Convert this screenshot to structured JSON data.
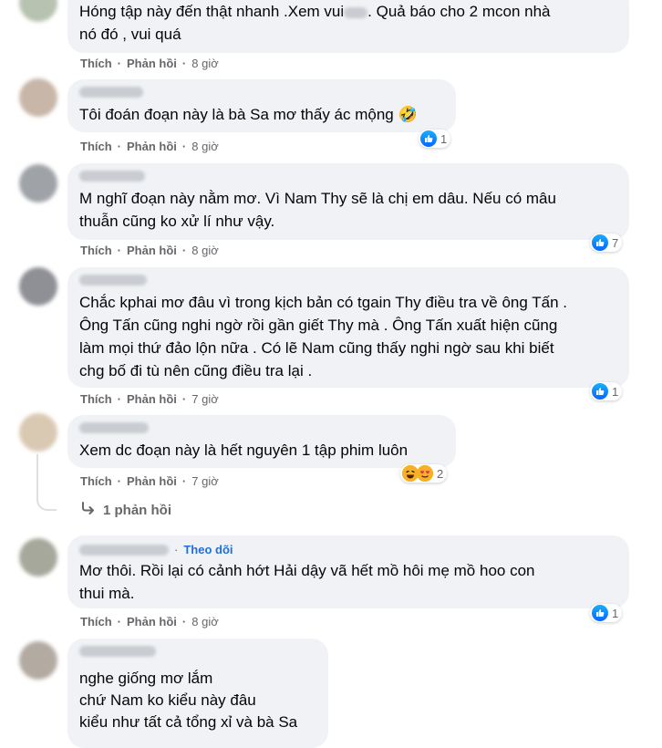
{
  "actions": {
    "like": "Thích",
    "reply": "Phản hồi",
    "dot": "·"
  },
  "colors": {
    "like_blue": "#0766ff",
    "bubble_bg": "#f0f2f5",
    "meta_gray": "#65676b",
    "follow_blue": "#216fdb"
  },
  "comments": [
    {
      "text": "Hóng tập này đến thật nhanh .Xem vui",
      "text_after_blur": ". Quả báo cho 2 mcon nhà\nnó đó , vui quá",
      "time": "8 giờ"
    },
    {
      "text": "Tôi đoán đoạn này là bà Sa mơ thấy ác mộng 🤣",
      "time": "8 giờ",
      "reaction_icon": "like-icon",
      "reaction_count": "1"
    },
    {
      "text": "M nghĩ đoạn này nằm mơ. Vì Nam Thy sẽ là chị em dâu. Nếu có mâu\nthuẫn cũng ko xử lí như vậy.",
      "time": "8 giờ",
      "reaction_icon": "like-icon",
      "reaction_count": "7"
    },
    {
      "text": "Chắc kphai mơ đâu vì trong kịch bản có tgain Thy điều tra về ông Tấn .\nÔng Tấn cũng nghi ngờ rồi gần giết Thy mà . Ông Tấn xuất hiện cũng\nlàm mọi thứ đảo lộn nữa . Có lẽ Nam cũng thấy nghi ngờ sau khi biết\nchg bố đi tù nên cũng điều tra lại .",
      "time": "7 giờ",
      "reaction_icon": "like-icon",
      "reaction_count": "1"
    },
    {
      "text": "Xem dc đoạn này là hết nguyên 1 tập phim luôn",
      "time": "7 giờ",
      "reaction_icons": [
        "haha-icon",
        "love-face-icon"
      ],
      "reaction_count": "2",
      "replies_link": "1 phản hồi"
    },
    {
      "follow": "Theo dõi",
      "text": "Mơ thôi. Rồi lại có cảnh hớt Hải dậy vã hết mồ hôi mẹ mồ hoo con\nthui mà.",
      "time": "8 giờ",
      "reaction_icon": "like-icon",
      "reaction_count": "1"
    },
    {
      "text": "nghe giống mơ lắm\nchứ Nam ko kiểu này đâu\nkiểu như tất cả tổng xỉ và bà Sa"
    }
  ]
}
